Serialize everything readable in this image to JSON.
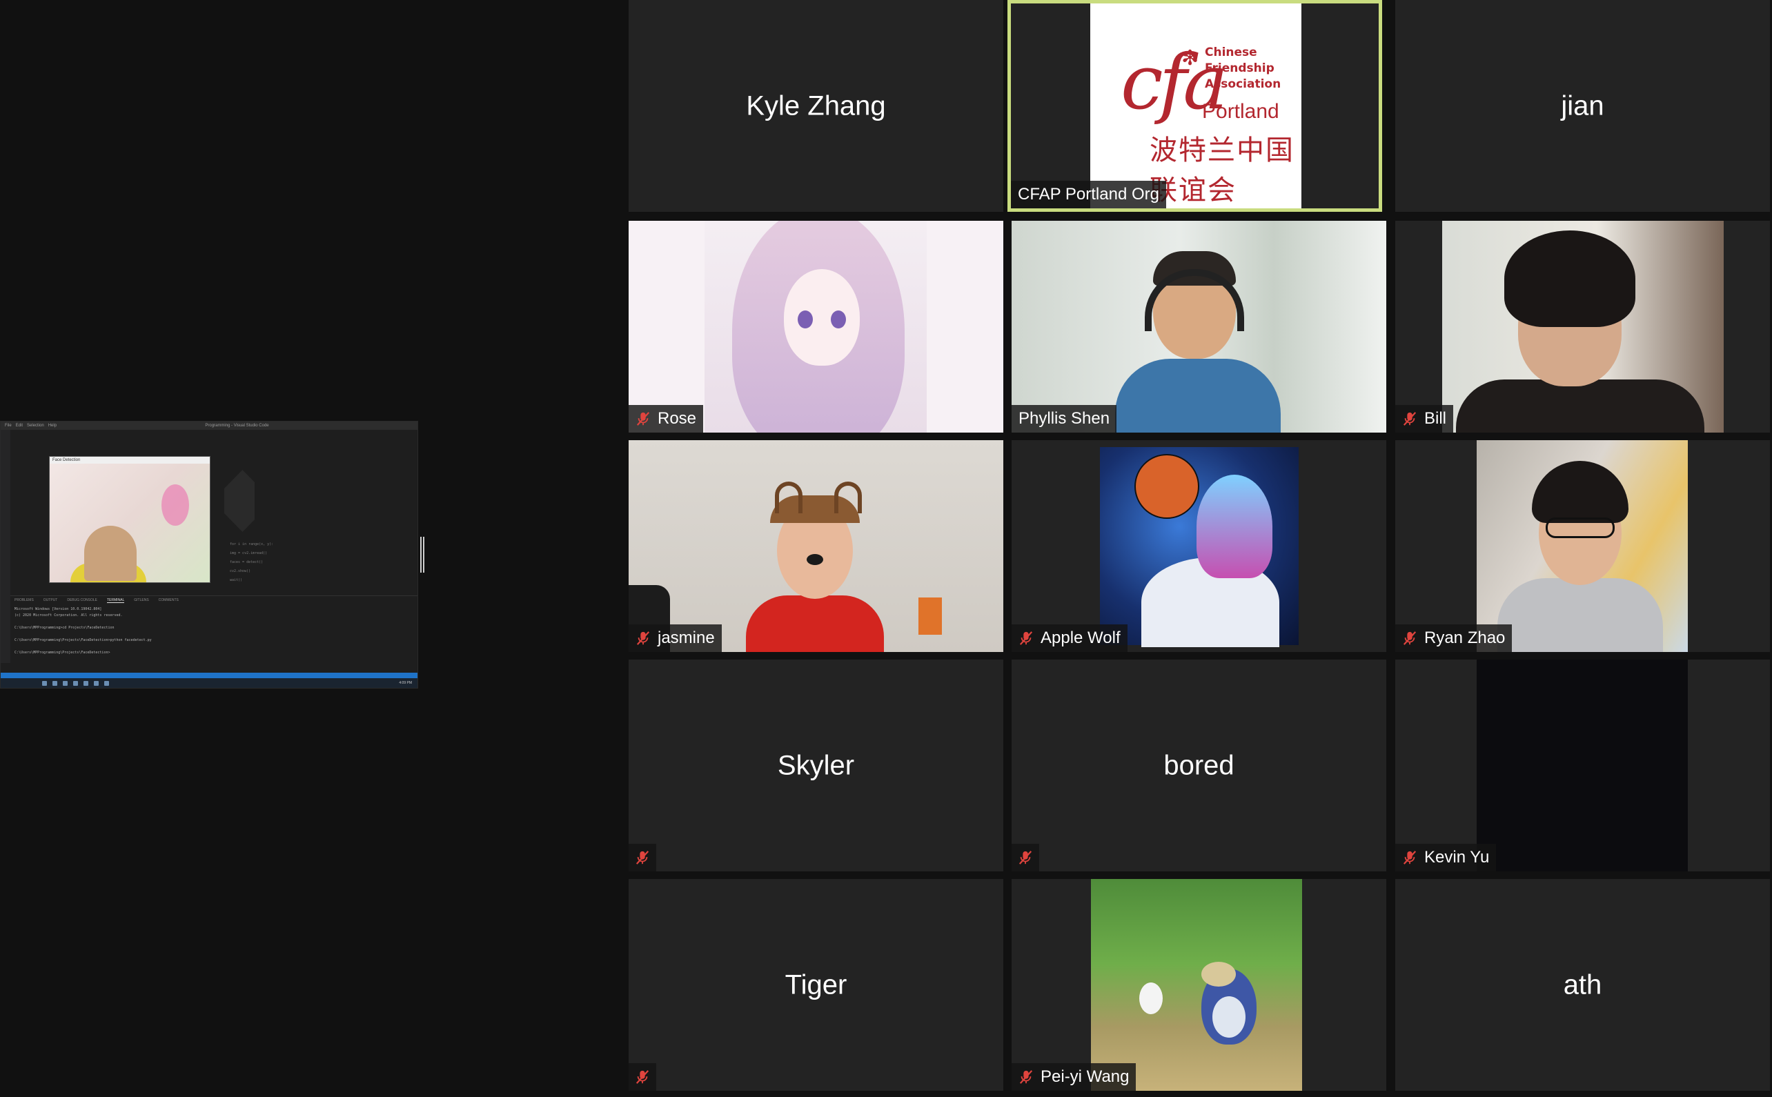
{
  "share": {
    "window_title": "Programming - Visual Studio Code",
    "menu": [
      "File",
      "Edit",
      "Selection",
      "Help"
    ],
    "preview_title": "Face Detection",
    "code_lines": [
      "for i in range(x, y):",
      "    img = cv2.imread()",
      "    faces = detect()",
      "    cv2.show()",
      "    wait()"
    ],
    "panel_tabs": [
      "PROBLEMS",
      "OUTPUT",
      "DEBUG CONSOLE",
      "TERMINAL",
      "GITLENS",
      "COMMENTS"
    ],
    "active_panel_tab": "TERMINAL",
    "terminal_lines": [
      "Microsoft Windows [Version 10.0.19042.804]",
      "(c) 2020 Microsoft Corporation. All rights reserved.",
      "",
      "C:\\Users\\MPProgramming>cd Projects\\FaceDetection",
      "",
      "C:\\Users\\MPProgramming\\Projects\\FaceDetection>python facedetect.py",
      "",
      "C:\\Users\\MPProgramming\\Projects\\FaceDetection>"
    ],
    "clock": "4:09 PM"
  },
  "participants": [
    {
      "name": "Kyle Zhang",
      "muted": false
    },
    {
      "name": "CFAP Portland Org",
      "muted": false
    },
    {
      "name": "jian",
      "muted": false
    },
    {
      "name": "Rose",
      "muted": true
    },
    {
      "name": "Phyllis Shen",
      "muted": false
    },
    {
      "name": "Bill",
      "muted": true
    },
    {
      "name": "jasmine",
      "muted": true
    },
    {
      "name": "Apple Wolf",
      "muted": true
    },
    {
      "name": "Ryan Zhao",
      "muted": true
    },
    {
      "name": "Skyler",
      "muted": true
    },
    {
      "name": "bored",
      "muted": true
    },
    {
      "name": "Kevin Yu",
      "muted": true
    },
    {
      "name": "Tiger",
      "muted": true
    },
    {
      "name": "Pei-yi Wang",
      "muted": true
    },
    {
      "name": "ath",
      "muted": false
    }
  ],
  "cfap_logo": {
    "mark": "cfa",
    "lines": [
      "Chinese",
      "Friendship",
      "Association"
    ],
    "city": "Portland",
    "chinese": "波特兰中国联谊会"
  },
  "colors": {
    "active_speaker_border": "#c9dc7f",
    "muted_icon": "#e0443e",
    "tile_bg": "#232323",
    "app_bg": "#111111"
  },
  "icons": {
    "muted": "microphone-muted-icon"
  }
}
